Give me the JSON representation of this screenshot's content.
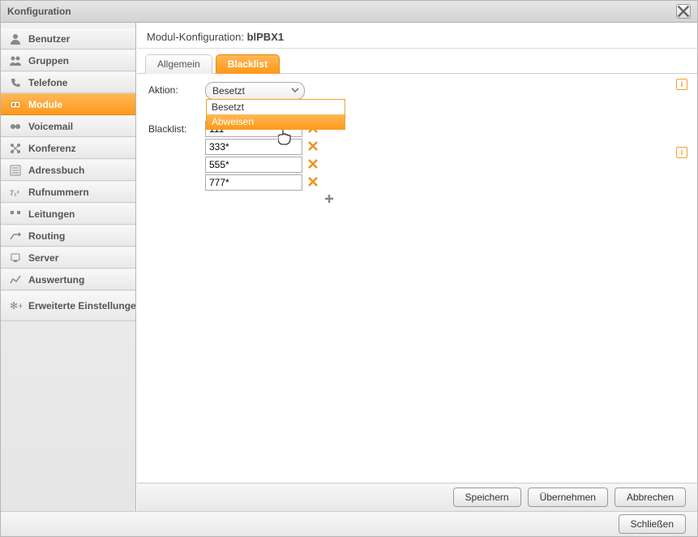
{
  "window_title": "Konfiguration",
  "sidebar": {
    "items": [
      {
        "label": "Benutzer"
      },
      {
        "label": "Gruppen"
      },
      {
        "label": "Telefone"
      },
      {
        "label": "Module"
      },
      {
        "label": "Voicemail"
      },
      {
        "label": "Konferenz"
      },
      {
        "label": "Adressbuch"
      },
      {
        "label": "Rufnummern"
      },
      {
        "label": "Leitungen"
      },
      {
        "label": "Routing"
      },
      {
        "label": "Server"
      },
      {
        "label": "Auswertung"
      },
      {
        "label": "Erweiterte Einstellungen"
      }
    ],
    "active_index": 3
  },
  "main": {
    "header_prefix": "Modul-Konfiguration: ",
    "header_name": "blPBX1",
    "tabs": [
      {
        "label": "Allgemein"
      },
      {
        "label": "Blacklist"
      }
    ],
    "active_tab": 1,
    "form": {
      "aktion_label": "Aktion:",
      "aktion_value": "Besetzt",
      "aktion_options": [
        "Besetzt",
        "Abweisen"
      ],
      "aktion_highlight": 1,
      "blacklist_label": "Blacklist:",
      "blacklist": [
        "111*",
        "333*",
        "555*",
        "777*"
      ]
    }
  },
  "buttons": {
    "save": "Speichern",
    "apply": "Übernehmen",
    "cancel": "Abbrechen",
    "close": "Schließen"
  },
  "info_glyph": "i"
}
